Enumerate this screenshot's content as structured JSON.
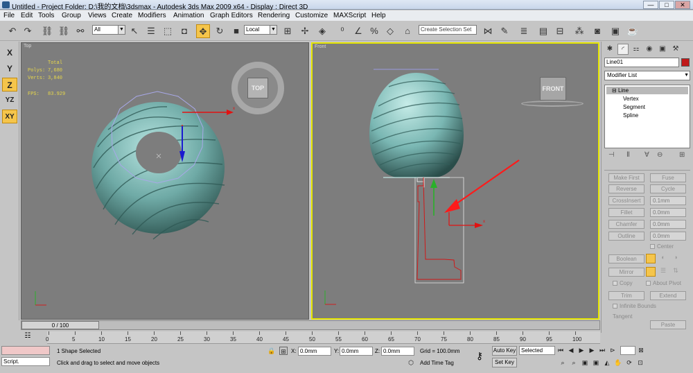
{
  "window": {
    "title": "Untitled    - Project Folder: D:\\我的文档\\3dsmax    - Autodesk 3ds Max  2009 x64      - Display : Direct 3D",
    "minimize": "—",
    "maximize": "□",
    "close": "✕"
  },
  "menu": [
    "File",
    "Edit",
    "Tools",
    "Group",
    "Views",
    "Create",
    "Modifiers",
    "Animation",
    "Graph Editors",
    "Rendering",
    "Customize",
    "MAXScript",
    "Help"
  ],
  "toolbar": {
    "selection_filter": "All",
    "ref_coord": "Local",
    "named_selection_placeholder": "Create Selection Set"
  },
  "axis_constraints": [
    "X",
    "Y",
    "Z",
    "YZ",
    "XY"
  ],
  "viewports": {
    "top": {
      "label": "Top",
      "stats_header": "Total",
      "polys_label": "Polys:",
      "polys_value": "7,680",
      "verts_label": "Verts:",
      "verts_value": "3,840",
      "fps_label": "FPS:",
      "fps_value": "83.929",
      "cube_label": "TOP"
    },
    "front": {
      "label": "Front",
      "cube_label": "FRONT"
    }
  },
  "command_panel": {
    "object_name": "Line01",
    "modifier_list": "Modifier List",
    "stack": {
      "root": "Line",
      "sub": [
        "Vertex",
        "Segment",
        "Spline"
      ]
    },
    "buttons": {
      "make_first": "Make First",
      "fuse": "Fuse",
      "reverse": "Reverse",
      "cycle": "Cycle",
      "crossinsert": "CrossInsert",
      "fillet": "Fillet",
      "chamfer": "Chamfer",
      "outline": "Outline",
      "boolean": "Boolean",
      "mirror": "Mirror",
      "trim": "Trim",
      "extend": "Extend",
      "paste": "Paste"
    },
    "spinners": {
      "crossinsert": "0.1mm",
      "fillet": "0.0mm",
      "chamfer": "0.0mm",
      "outline": "0.0mm"
    },
    "checks": {
      "center": "Center",
      "copy": "Copy",
      "about_pivot": "About Pivot",
      "infinite_bounds": "Infinite Bounds",
      "tangent": "Tangent"
    }
  },
  "timeline": {
    "slider": "0 / 100",
    "ticks": [
      "0",
      "5",
      "10",
      "15",
      "20",
      "25",
      "30",
      "35",
      "40",
      "45",
      "50",
      "55",
      "60",
      "65",
      "70",
      "75",
      "80",
      "85",
      "90",
      "95",
      "100"
    ]
  },
  "status": {
    "selection": "1 Shape Selected",
    "prompt": "Click and drag to select and move objects",
    "maxscript": "Script.",
    "x_label": "X:",
    "x_value": "0.0mm",
    "y_label": "Y:",
    "y_value": "0.0mm",
    "z_label": "Z:",
    "z_value": "0.0mm",
    "grid": "Grid = 100.0mm",
    "add_time_tag": "Add Time Tag",
    "auto_key": "Auto Key",
    "set_key": "Set Key",
    "selected": "Selected"
  },
  "colors": {
    "accent": "#f5c54b",
    "active_viewport_border": "#e6e600",
    "viewport_bg": "#7d7d7d",
    "object_color": "#c01818",
    "mesh_color": "#86c7c3"
  }
}
